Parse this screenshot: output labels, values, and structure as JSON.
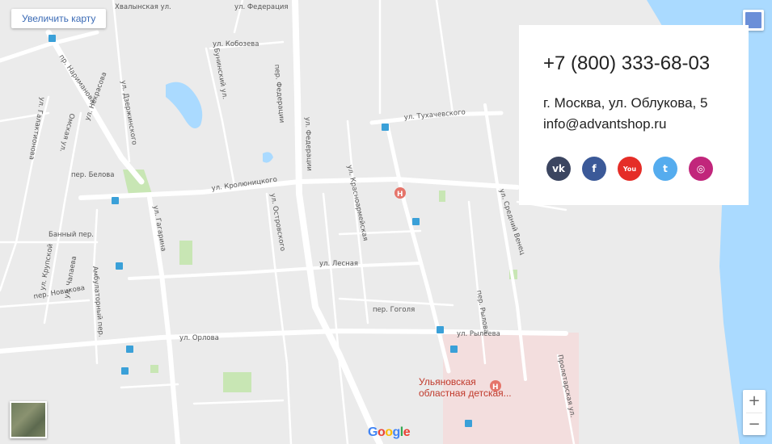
{
  "map": {
    "enlarge_label": "Увеличить карту",
    "streets": {
      "khvalynskaya": "Хвалынская ул.",
      "federatsii_top": "ул. Федерация",
      "kobozeva": "ул. Кобозева",
      "narimanova": "пр. Нариманова",
      "dzerzhinskogo": "ул. Дзержинского",
      "bunin": "Бунинский ул.",
      "fed_per": "пер. Федерации",
      "federatsii": "ул. Федерации",
      "tukhachevskogo": "ул. Тухачевского",
      "galaktionova": "ул. Галактионова",
      "omskaya": "Омская ул.",
      "nekrasova": "ул. Некрасова",
      "belova": "пер. Белова",
      "krolyunitskogo": "ул. Кролюницкого",
      "krasnoarmeiskaya": "ул. Красноармейская",
      "srednii_venets": "ул. Средний Венец",
      "gagarina": "ул. Гагарина",
      "ostrovskogo": "ул. Островского",
      "bannyi": "Банный пер.",
      "lesnaya": "ул. Лесная",
      "gogolya": "пер. Гоголя",
      "rylova": "пер. Рылова",
      "orlova": "ул. Орлова",
      "ryleeva": "ул. Рылеева",
      "proletarskaya": "Пролетарская ул.",
      "ambulatornyi": "Амбулаторный пер.",
      "novikova": "пер. Новикова",
      "chapaeva": "ул. Чапаева",
      "krupskoi": "ул. Крупской"
    },
    "poi": {
      "hospital_line1": "Ульяновская",
      "hospital_line2": "областная детская..."
    },
    "google": [
      "G",
      "o",
      "o",
      "g",
      "l",
      "e"
    ]
  },
  "contact": {
    "phone": "+7 (800) 333-68-03",
    "address": "г. Москва, ул. Облукова, 5",
    "email": "info@advantshop.ru",
    "social": [
      {
        "name": "vk",
        "glyph": "vk"
      },
      {
        "name": "facebook",
        "glyph": "f"
      },
      {
        "name": "youtube",
        "glyph": "You"
      },
      {
        "name": "twitter",
        "glyph": "t"
      },
      {
        "name": "instagram",
        "glyph": "◎"
      }
    ]
  },
  "colors": {
    "water": "#aadaff",
    "park": "#c8e6b4",
    "road": "#ffffff",
    "hospital_area": "#f3dede"
  }
}
